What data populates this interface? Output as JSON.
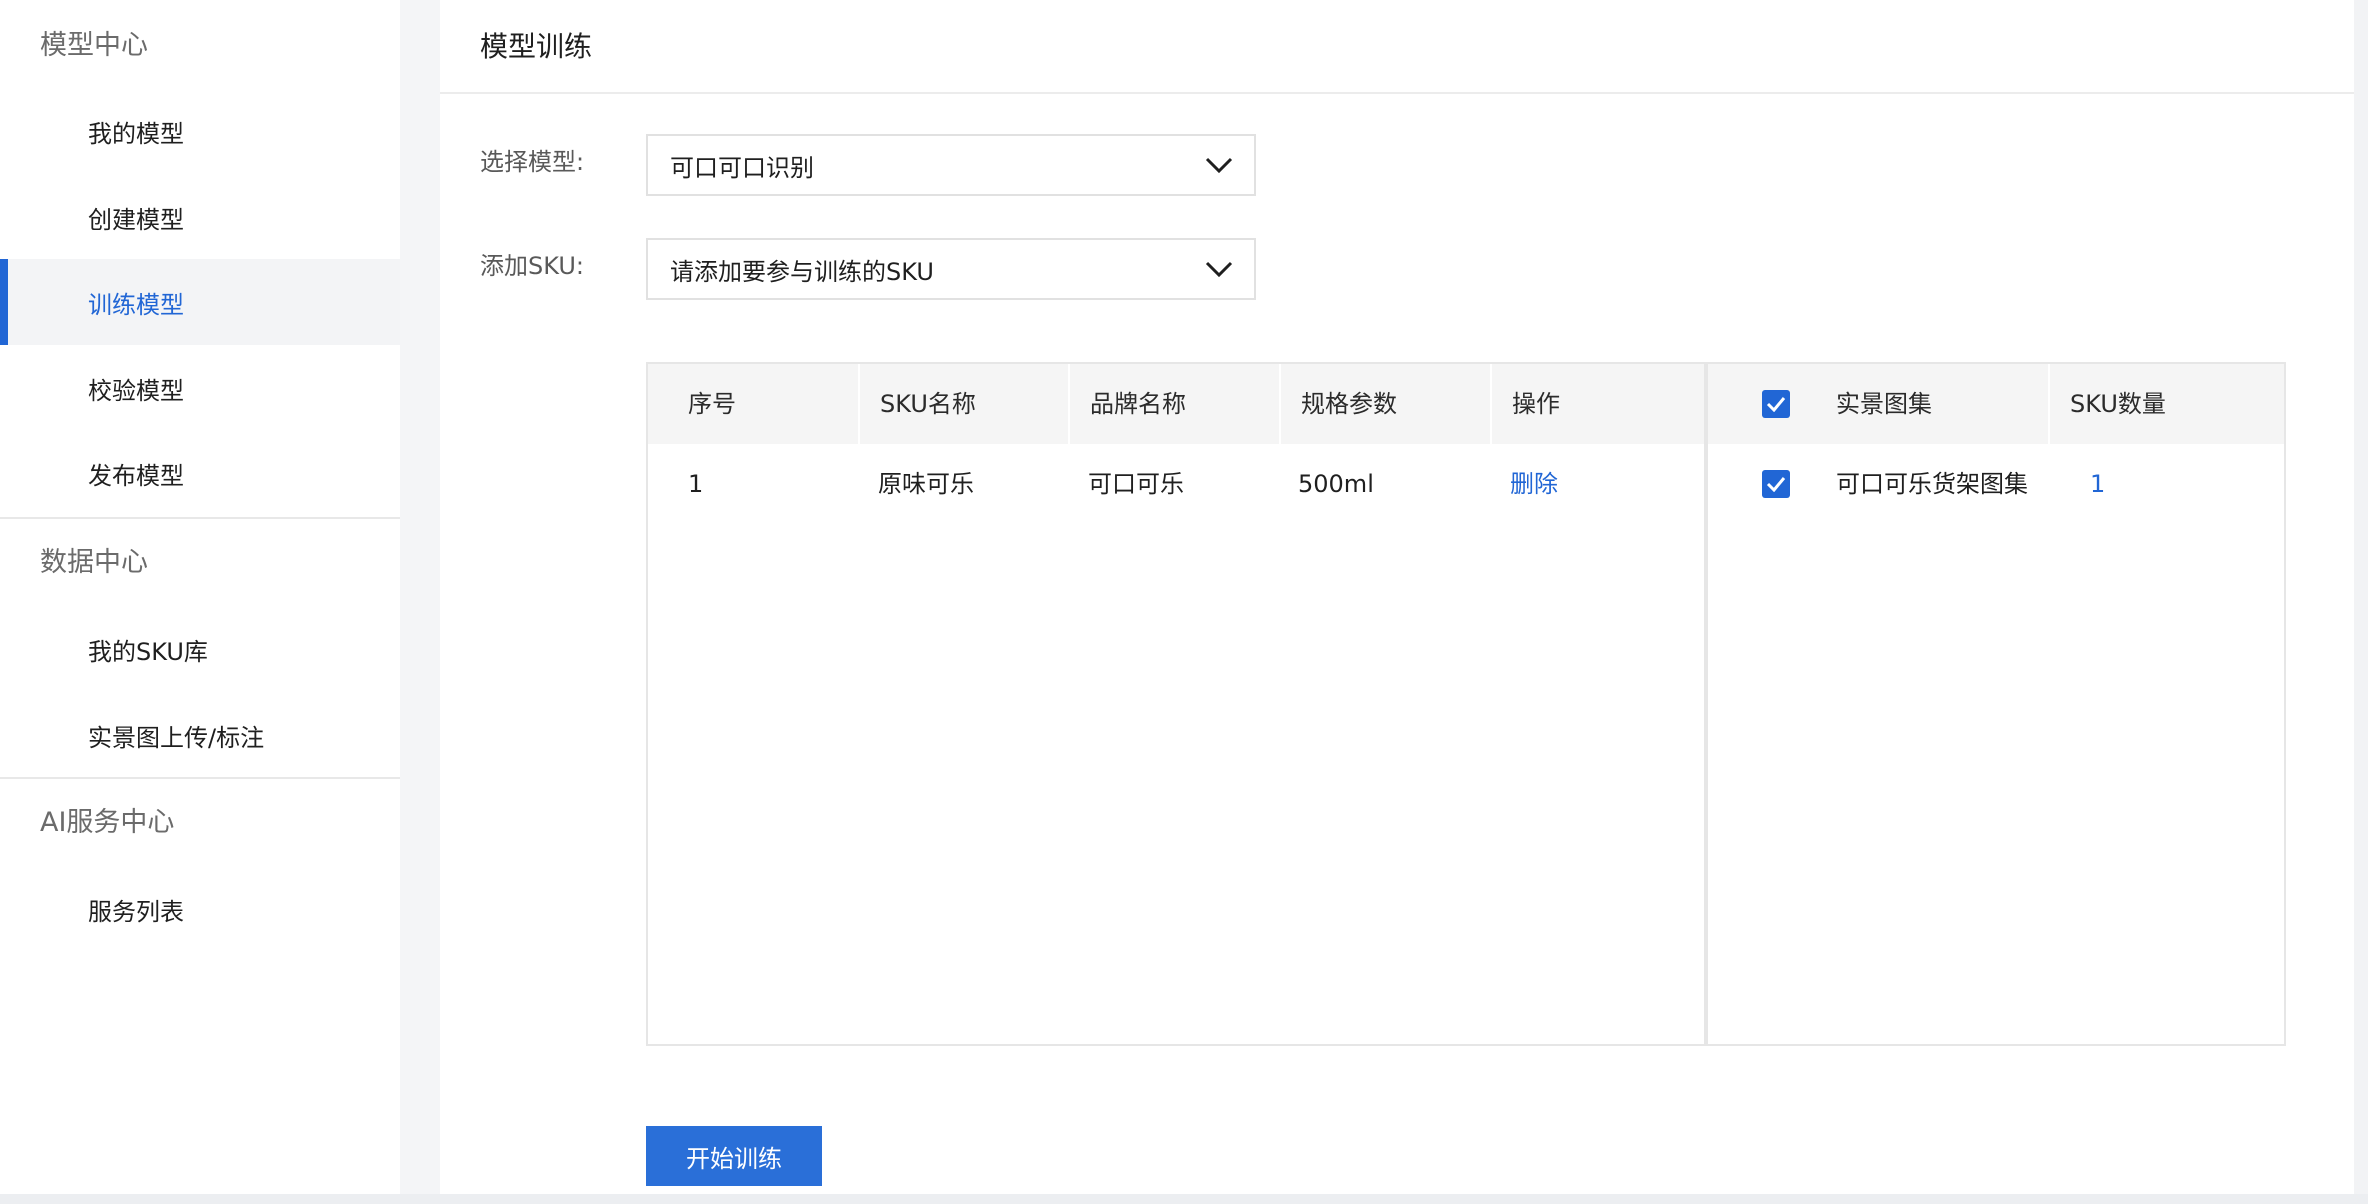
{
  "sidebar": {
    "groups": [
      {
        "title": "模型中心",
        "items": [
          {
            "label": "我的模型"
          },
          {
            "label": "创建模型"
          },
          {
            "label": "训练模型"
          },
          {
            "label": "校验模型"
          },
          {
            "label": "发布模型"
          }
        ]
      },
      {
        "title": "数据中心",
        "items": [
          {
            "label": "我的SKU库"
          },
          {
            "label": "实景图上传/标注"
          }
        ]
      },
      {
        "title": "AI服务中心",
        "items": [
          {
            "label": "服务列表"
          }
        ]
      }
    ],
    "active_item": "训练模型"
  },
  "main": {
    "title": "模型训练",
    "model_select": {
      "label": "选择模型:",
      "value": "可口可口识别"
    },
    "sku_select": {
      "label": "添加SKU:",
      "value": "请添加要参与训练的SKU"
    },
    "sku_table": {
      "headers": [
        "序号",
        "SKU名称",
        "品牌名称",
        "规格参数",
        "操作"
      ],
      "rows": [
        {
          "index": "1",
          "name": "原味可乐",
          "brand": "可口可乐",
          "spec": "500ml",
          "action": "删除"
        }
      ]
    },
    "image_table": {
      "headers": [
        "实景图集",
        "SKU数量"
      ],
      "header_checked": true,
      "rows": [
        {
          "checked": true,
          "name": "可口可乐货架图集",
          "count": "1"
        }
      ]
    },
    "start_button": "开始训练"
  },
  "colors": {
    "accent": "#2166d5",
    "button": "#2a6fd8"
  },
  "icons": {
    "select_arrow": "chevron-down-icon",
    "check": "checkmark-icon"
  }
}
